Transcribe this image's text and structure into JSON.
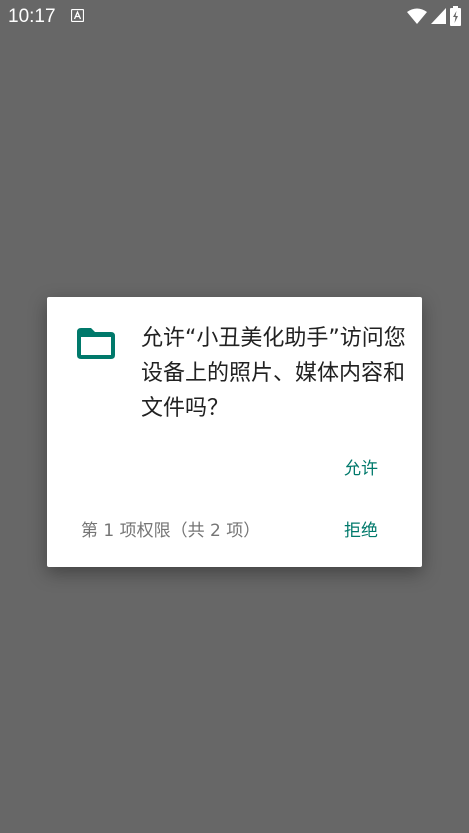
{
  "status_bar": {
    "time": "10:17",
    "notification_icon": "font-a-icon",
    "wifi_icon": "wifi-icon",
    "signal_icon": "cell-signal-icon",
    "battery_icon": "battery-charging-icon"
  },
  "dialog": {
    "icon": "folder-icon",
    "message": "允许“小丑美化助手”访问您设备上的照片、媒体内容和文件吗？",
    "allow_label": "允许",
    "deny_label": "拒绝",
    "permission_counter": "第 1 项权限（共 2 项）"
  },
  "colors": {
    "scrim": "#676767",
    "accent": "#00796b",
    "text_primary": "#212121",
    "text_secondary": "#757575"
  }
}
